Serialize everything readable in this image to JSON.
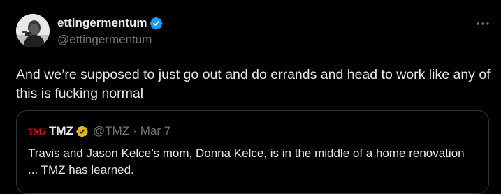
{
  "colors": {
    "background": "#000000",
    "primary_text": "#e7e9ea",
    "secondary_text": "#71767b",
    "verified_blue": "#1d9bf0",
    "verified_gold": "#e2b719",
    "border": "#2f3336",
    "tmz_red": "#d4141b"
  },
  "tweet": {
    "author": {
      "display_name": "ettingermentum",
      "handle": "@ettingermentum",
      "verified_icon": "verified-badge-blue"
    },
    "more_icon": "more-horizontal-icon",
    "text": "And we’re supposed to just go out and do errands and head to work like any of this is fucking normal"
  },
  "quote": {
    "author": {
      "logo_icon": "tmz-logo",
      "display_name": "TMZ",
      "verified_icon": "verified-badge-gold",
      "handle": "@TMZ",
      "separator": "·",
      "date": "Mar 7"
    },
    "text": "Travis and Jason Kelce’s mom, Donna Kelce, is in the middle of a home renovation ... TMZ has learned."
  }
}
